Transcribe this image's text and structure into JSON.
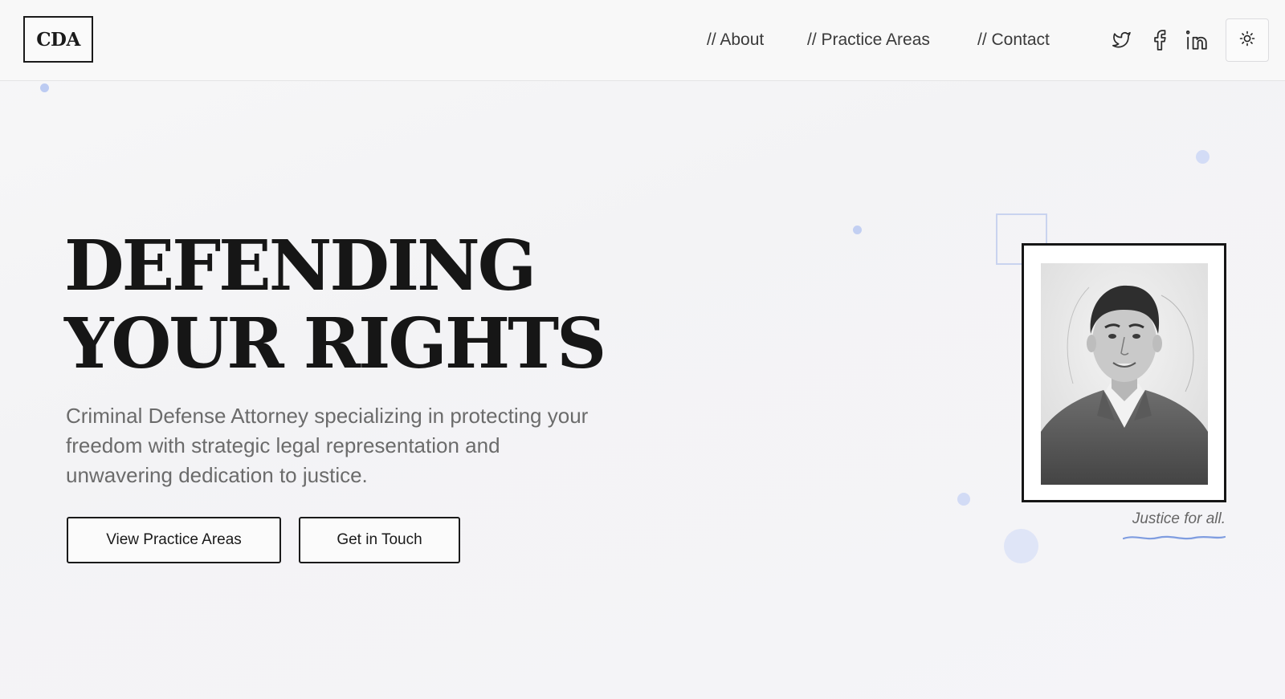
{
  "logo": {
    "text": "CDA"
  },
  "nav": {
    "items": [
      {
        "label": "// About"
      },
      {
        "label": "// Practice Areas"
      },
      {
        "label": "// Contact"
      }
    ]
  },
  "social": {
    "icons": [
      "twitter-icon",
      "facebook-icon",
      "linkedin-icon"
    ]
  },
  "theme_toggle": {
    "icon": "sun-icon"
  },
  "hero": {
    "headline_line1": "DEFENDING",
    "headline_line2": "YOUR RIGHTS",
    "subtitle": "Criminal Defense Attorney specializing in protecting your freedom with strategic legal representation and unwavering dedication to justice.",
    "buttons": [
      {
        "label": "View Practice Areas"
      },
      {
        "label": "Get in Touch"
      }
    ]
  },
  "portrait": {
    "caption": "Justice for all."
  },
  "colors": {
    "text_dark": "#161616",
    "text_muted": "#6b6b6b",
    "accent_blue": "#8fa8e6",
    "decoration": "#c8d4f4"
  }
}
